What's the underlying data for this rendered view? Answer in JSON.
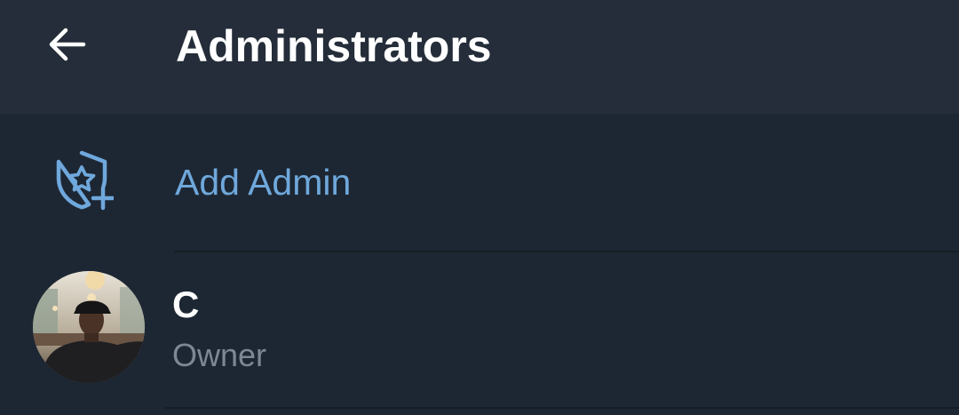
{
  "header": {
    "back_icon": "arrow-left-icon",
    "title": "Administrators"
  },
  "add_admin": {
    "icon": "shield-star-plus-icon",
    "label": "Add Admin",
    "accent_color": "#6fa8dc"
  },
  "admins": [
    {
      "name": "C",
      "role": "Owner",
      "avatar": "avatar-photo"
    }
  ],
  "colors": {
    "background": "#1d2733",
    "header": "#242d39",
    "primary_text": "#ffffff",
    "secondary_text": "#7d8894",
    "accent": "#6fa8dc"
  }
}
